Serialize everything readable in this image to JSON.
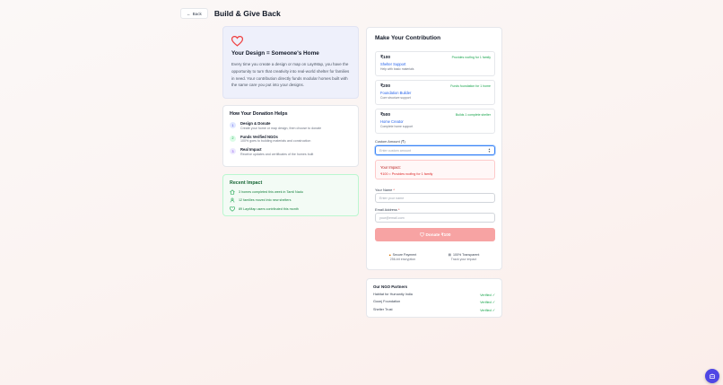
{
  "header": {
    "back_label": "Back",
    "title": "Build & Give Back"
  },
  "hero": {
    "title": "Your Design = Someone's Home",
    "text": "Every time you create a design or map on LayrMap, you have the opportunity to turn that creativity into real-world shelter for families in need. Your contribution directly funds modular homes built with the same care you put into your designs."
  },
  "how": {
    "title": "How Your Donation Helps",
    "items": [
      {
        "num": "1",
        "title": "Design & Donate",
        "desc": "Create your home or map design, then choose to donate"
      },
      {
        "num": "2",
        "title": "Funds Verified NGOs",
        "desc": "100% goes to building materials and construction"
      },
      {
        "num": "3",
        "title": "Real Impact",
        "desc": "Receive updates and certificates of the homes built"
      }
    ]
  },
  "recent": {
    "title": "Recent Impact",
    "items": [
      {
        "icon": "home-icon",
        "text": "3 homes completed this week in Tamil Nadu"
      },
      {
        "icon": "users-icon",
        "text": "12 families moved into new shelters"
      },
      {
        "icon": "heart-icon",
        "text": "89 LayrMap users contributed this month"
      }
    ]
  },
  "contribution": {
    "title": "Make Your Contribution",
    "tiers": [
      {
        "amount": "₹100",
        "name": "Shelter Support",
        "desc": "Help with basic materials",
        "badge": "Provides roofing for 1 family"
      },
      {
        "amount": "₹200",
        "name": "Foundation Builder",
        "desc": "Core structure support",
        "badge": "Funds foundation for 1 home"
      },
      {
        "amount": "₹500",
        "name": "Home Creator",
        "desc": "Complete home support",
        "badge": "Builds 1 complete shelter"
      }
    ],
    "custom_label": "Custom Amount (₹)",
    "custom_placeholder": "Enter custom amount",
    "impact_title": "Your Impact:",
    "impact_text": "₹100 = Provides roofing for 1 family",
    "name_label": "Your Name",
    "name_placeholder": "Enter your name",
    "email_label": "Email Address",
    "email_placeholder": "your@email.com",
    "required_mark": "*",
    "donate_label": "Donate ₹100",
    "trust": [
      {
        "title": "Secure Payment",
        "desc": "256-bit encryption"
      },
      {
        "title": "100% Transparent",
        "desc": "Track your impact"
      }
    ]
  },
  "partners": {
    "title": "Our NGO Partners",
    "items": [
      {
        "name": "Habitat for Humanity India",
        "status": "Verified ✓"
      },
      {
        "name": "Goonj Foundation",
        "status": "Verified ✓"
      },
      {
        "name": "Shelter Trust",
        "status": "Verified ✓"
      }
    ]
  },
  "colors": {
    "accent": "#ef4444",
    "link": "#2563eb",
    "success": "#16a34a",
    "fab": "#4f46e5"
  }
}
